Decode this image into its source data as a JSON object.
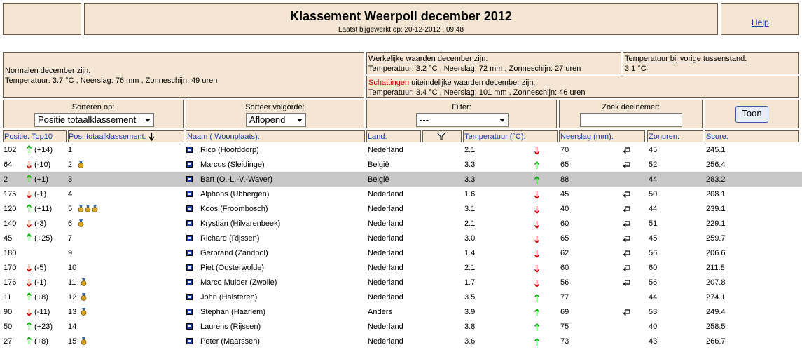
{
  "header": {
    "title": "Klassement Weerpoll december 2012",
    "updated": "Laatst bijgewerkt op: 20-12-2012 , 09:48",
    "help": "Help"
  },
  "info": {
    "normals_label": "Normalen december zijn:",
    "normals_value": "Temperatuur: 3.7 °C , Neerslag: 76 mm , Zonneschijn: 49 uren",
    "actual_label": "Werkelijke waarden december zijn:",
    "actual_value": "Temperatuur: 3.2 °C , Neerslag: 72 mm , Zonneschijn: 27 uren",
    "prev_label": "Temperatuur bij vorige tussenstand:",
    "prev_value": "3.1 °C",
    "estimates_red": "Schattingen",
    "estimates_label": " uiteindelijke waarden december zijn:",
    "estimates_value": "Temperatuur: 3.4 °C , Neerslag: 101 mm , Zonneschijn: 46 uren"
  },
  "controls": {
    "sort_label": "Sorteren op:",
    "sort_value": "Positie totaalklassement",
    "order_label": "Sorteer volgorde:",
    "order_value": "Aflopend",
    "filter_label": "Filter:",
    "filter_value": "---",
    "search_label": "Zoek deelnemer:",
    "search_value": "",
    "button": "Toon"
  },
  "columns": {
    "positie": "Positie:",
    "top10": "Top10",
    "pos_total": "Pos. totaalklassement:",
    "naam": "Naam ( Woonplaats):",
    "land": "Land:",
    "temp": "Temperatuur (°C):",
    "neerslag": "Neerslag (mm):",
    "zon": "Zonuren:",
    "score": "Score:"
  },
  "colors": {
    "panel": "#f5e6d3",
    "highlight": "#c8c8c8",
    "link": "#1a3aa0",
    "up": "#00aa00",
    "down": "#cc0000"
  },
  "rows": [
    {
      "pos": "102",
      "dir": "up",
      "chg": "(+14)",
      "total": "1",
      "medals": 0,
      "name": "Rico (Hoofddorp)",
      "land": "Nederland",
      "temp": "2.1",
      "tdir": "down",
      "rain": "70",
      "ret": true,
      "sun": "45",
      "score": "245.1"
    },
    {
      "pos": "64",
      "dir": "down",
      "chg": "(-10)",
      "total": "2",
      "medals": 1,
      "name": "Marcus (Sleidinge)",
      "land": "België",
      "temp": "3.3",
      "tdir": "up",
      "rain": "65",
      "ret": true,
      "sun": "52",
      "score": "256.4"
    },
    {
      "pos": "2",
      "dir": "up",
      "chg": "(+1)",
      "total": "3",
      "medals": 0,
      "name": "Bart (O.-L.-V.-Waver)",
      "land": "België",
      "temp": "3.3",
      "tdir": "up",
      "rain": "88",
      "ret": false,
      "sun": "44",
      "score": "283.2",
      "hi": true
    },
    {
      "pos": "175",
      "dir": "down",
      "chg": "(-1)",
      "total": "4",
      "medals": 0,
      "name": "Alphons (Ubbergen)",
      "land": "Nederland",
      "temp": "1.6",
      "tdir": "down",
      "rain": "45",
      "ret": true,
      "sun": "50",
      "score": "208.1"
    },
    {
      "pos": "120",
      "dir": "up",
      "chg": "(+11)",
      "total": "5",
      "medals": 3,
      "name": "Koos (Froombosch)",
      "land": "Nederland",
      "temp": "3.1",
      "tdir": "down",
      "rain": "40",
      "ret": true,
      "sun": "44",
      "score": "239.1"
    },
    {
      "pos": "140",
      "dir": "down",
      "chg": "(-3)",
      "total": "6",
      "medals": 1,
      "name": "Krystian (Hilvarenbeek)",
      "land": "Nederland",
      "temp": "2.1",
      "tdir": "down",
      "rain": "60",
      "ret": true,
      "sun": "51",
      "score": "229.1"
    },
    {
      "pos": "45",
      "dir": "up",
      "chg": "(+25)",
      "total": "7",
      "medals": 0,
      "name": "Richard (Rijssen)",
      "land": "Nederland",
      "temp": "3.0",
      "tdir": "down",
      "rain": "65",
      "ret": true,
      "sun": "45",
      "score": "259.7"
    },
    {
      "pos": "180",
      "dir": "",
      "chg": "",
      "total": "9",
      "medals": 0,
      "name": "Gerbrand (Zandpol)",
      "land": "Nederland",
      "temp": "1.4",
      "tdir": "down",
      "rain": "62",
      "ret": true,
      "sun": "56",
      "score": "206.6"
    },
    {
      "pos": "170",
      "dir": "down",
      "chg": "(-5)",
      "total": "10",
      "medals": 0,
      "name": "Piet (Oosterwolde)",
      "land": "Nederland",
      "temp": "2.1",
      "tdir": "down",
      "rain": "60",
      "ret": true,
      "sun": "60",
      "score": "211.8"
    },
    {
      "pos": "176",
      "dir": "down",
      "chg": "(-1)",
      "total": "11",
      "medals": 1,
      "name": "Marco Mulder (Zwolle)",
      "land": "Nederland",
      "temp": "1.7",
      "tdir": "down",
      "rain": "56",
      "ret": true,
      "sun": "56",
      "score": "207.8"
    },
    {
      "pos": "11",
      "dir": "up",
      "chg": "(+8)",
      "total": "12",
      "medals": 1,
      "name": "John (Halsteren)",
      "land": "Nederland",
      "temp": "3.5",
      "tdir": "up",
      "rain": "77",
      "ret": false,
      "sun": "44",
      "score": "274.1"
    },
    {
      "pos": "90",
      "dir": "down",
      "chg": "(-11)",
      "total": "13",
      "medals": 1,
      "name": "Stephan (Haarlem)",
      "land": "Anders",
      "temp": "3.9",
      "tdir": "up",
      "rain": "69",
      "ret": true,
      "sun": "53",
      "score": "249.4"
    },
    {
      "pos": "50",
      "dir": "up",
      "chg": "(+23)",
      "total": "14",
      "medals": 0,
      "name": "Laurens (Rijssen)",
      "land": "Nederland",
      "temp": "3.8",
      "tdir": "up",
      "rain": "75",
      "ret": false,
      "sun": "40",
      "score": "258.5"
    },
    {
      "pos": "27",
      "dir": "up",
      "chg": "(+8)",
      "total": "15",
      "medals": 1,
      "name": "Peter (Maarssen)",
      "land": "Nederland",
      "temp": "3.6",
      "tdir": "up",
      "rain": "73",
      "ret": false,
      "sun": "43",
      "score": "266.7"
    }
  ]
}
